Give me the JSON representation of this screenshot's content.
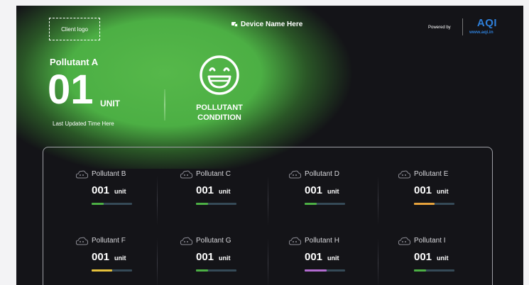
{
  "header": {
    "client_logo_label": "Client logo",
    "device_name": "Device Name Here",
    "powered_by_label": "Powered by",
    "brand_logo_text": "AQI",
    "brand_url": "www.aqi.in"
  },
  "main_reading": {
    "pollutant_name": "Pollutant A",
    "value": "01",
    "unit": "UNIT",
    "last_updated": "Last Updated Time Here",
    "condition_label": "POLLUTANT CONDITION",
    "condition_icon": "grinning-face-icon",
    "accent_color": "#56b84a"
  },
  "pollutants": [
    {
      "name": "Pollutant B",
      "value": "001",
      "unit": "unit",
      "level": 0.3,
      "bar_color": "#4caf44"
    },
    {
      "name": "Pollutant C",
      "value": "001",
      "unit": "unit",
      "level": 0.3,
      "bar_color": "#4caf44"
    },
    {
      "name": "Pollutant D",
      "value": "001",
      "unit": "unit",
      "level": 0.3,
      "bar_color": "#4caf44"
    },
    {
      "name": "Pollutant E",
      "value": "001",
      "unit": "unit",
      "level": 0.5,
      "bar_color": "#e6a23c"
    },
    {
      "name": "Pollutant F",
      "value": "001",
      "unit": "unit",
      "level": 0.5,
      "bar_color": "#e6c23c"
    },
    {
      "name": "Pollutant G",
      "value": "001",
      "unit": "unit",
      "level": 0.3,
      "bar_color": "#4caf44"
    },
    {
      "name": "Pollutant H",
      "value": "001",
      "unit": "unit",
      "level": 0.55,
      "bar_color": "#b26bd0"
    },
    {
      "name": "Pollutant I",
      "value": "001",
      "unit": "unit",
      "level": 0.3,
      "bar_color": "#4caf44"
    }
  ]
}
